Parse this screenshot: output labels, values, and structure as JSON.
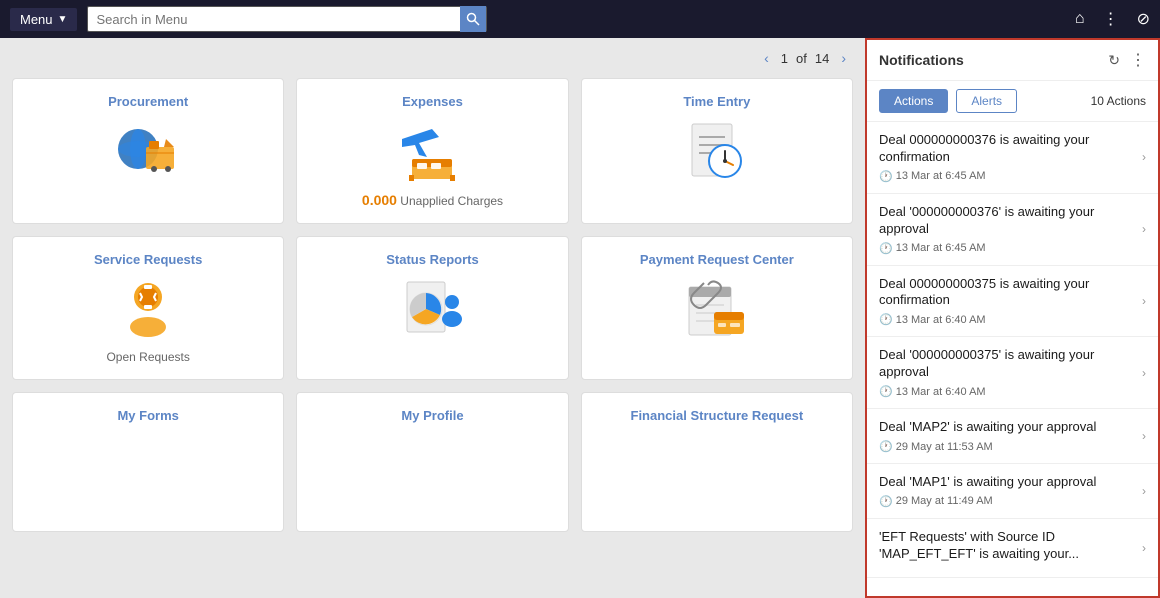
{
  "topNav": {
    "menuLabel": "Menu",
    "searchPlaceholder": "Search in Menu"
  },
  "pagination": {
    "current": "1",
    "total": "14",
    "separator": "of"
  },
  "tiles": [
    {
      "id": "procurement",
      "title": "Procurement",
      "icon": "procurement",
      "subtitle": ""
    },
    {
      "id": "expenses",
      "title": "Expenses",
      "icon": "expenses",
      "subtitle": "0.000 Unapplied Charges"
    },
    {
      "id": "time-entry",
      "title": "Time Entry",
      "icon": "time-entry",
      "subtitle": ""
    },
    {
      "id": "service-requests",
      "title": "Service Requests",
      "icon": "service-requests",
      "subtitle": "Open Requests"
    },
    {
      "id": "status-reports",
      "title": "Status Reports",
      "icon": "status-reports",
      "subtitle": ""
    },
    {
      "id": "payment-request",
      "title": "Payment Request Center",
      "icon": "payment-request",
      "subtitle": ""
    },
    {
      "id": "my-forms",
      "title": "My Forms",
      "icon": "my-forms",
      "subtitle": ""
    },
    {
      "id": "my-profile",
      "title": "My Profile",
      "icon": "my-profile",
      "subtitle": ""
    },
    {
      "id": "financial-structure",
      "title": "Financial Structure Request",
      "icon": "financial-structure",
      "subtitle": ""
    }
  ],
  "notifications": {
    "title": "Notifications",
    "tabs": [
      {
        "id": "actions",
        "label": "Actions",
        "active": true
      },
      {
        "id": "alerts",
        "label": "Alerts",
        "active": false
      }
    ],
    "actionsCount": "10 Actions",
    "items": [
      {
        "id": 1,
        "title": "Deal 000000000376 is awaiting your confirmation",
        "time": "13 Mar at 6:45 AM"
      },
      {
        "id": 2,
        "title": "Deal '000000000376' is awaiting your approval",
        "time": "13 Mar at 6:45 AM"
      },
      {
        "id": 3,
        "title": "Deal 000000000375 is awaiting your confirmation",
        "time": "13 Mar at 6:40 AM"
      },
      {
        "id": 4,
        "title": "Deal '000000000375' is awaiting your approval",
        "time": "13 Mar at 6:40 AM"
      },
      {
        "id": 5,
        "title": "Deal 'MAP2' is awaiting your approval",
        "time": "29 May at 11:53 AM"
      },
      {
        "id": 6,
        "title": "Deal 'MAP1' is awaiting your approval",
        "time": "29 May at 11:49 AM"
      },
      {
        "id": 7,
        "title": "'EFT Requests' with Source ID 'MAP_EFT_EFT' is awaiting your...",
        "time": ""
      }
    ]
  }
}
